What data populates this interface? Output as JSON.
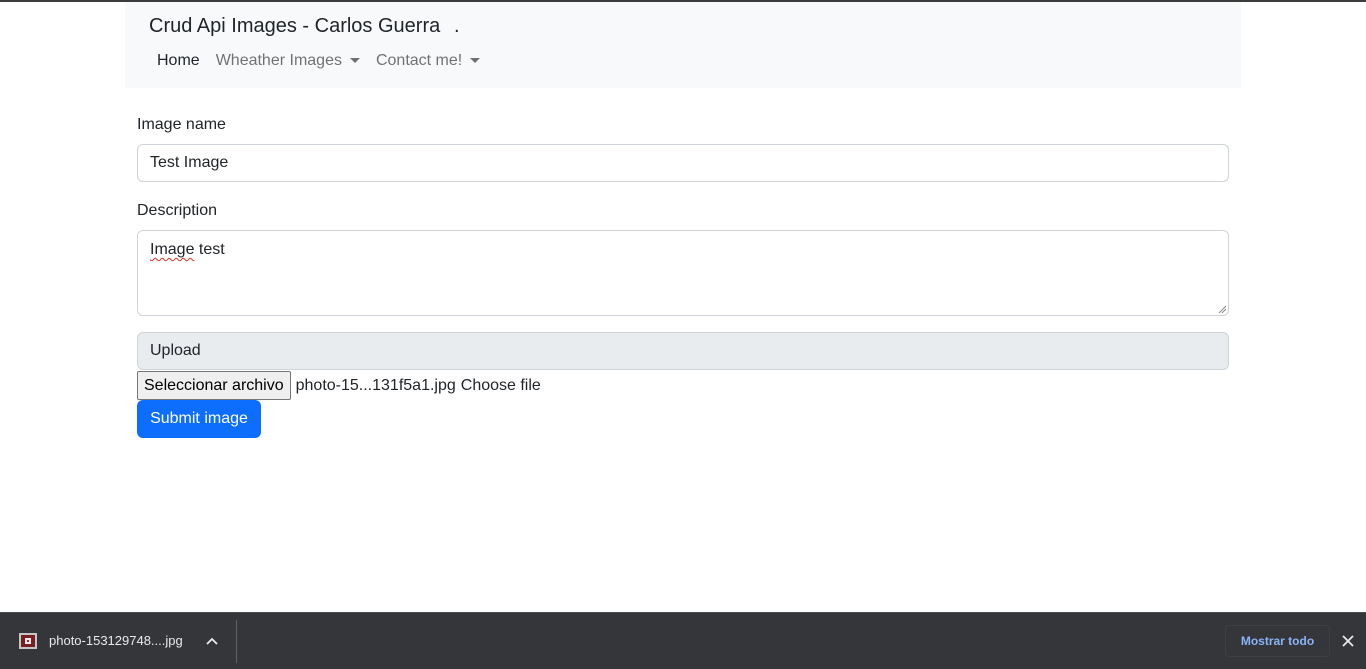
{
  "navbar": {
    "brand": "Crud Api Images - Carlos Guerra",
    "brand_dot": ".",
    "items": [
      {
        "label": "Home",
        "active": true,
        "dropdown": false
      },
      {
        "label": "Wheather Images",
        "active": false,
        "dropdown": true
      },
      {
        "label": "Contact me!",
        "active": false,
        "dropdown": true
      }
    ]
  },
  "form": {
    "name_label": "Image name",
    "name_value": "Test Image",
    "description_label": "Description",
    "description_misspelled": "Image",
    "description_rest": " test",
    "upload_label": "Upload",
    "file_button": "Seleccionar archivo",
    "file_name": "photo-15...131f5a1.jpg",
    "file_choose": "Choose file",
    "submit_label": "Submit image"
  },
  "download_bar": {
    "file_name": "photo-153129748....jpg",
    "show_all": "Mostrar todo",
    "icons": [
      "image-file-icon",
      "chevron-up-icon",
      "close-icon"
    ]
  },
  "colors": {
    "navbar_bg": "#f8f9fa",
    "primary": "#0d6efd",
    "download_bar_bg": "#35363a",
    "link_blue": "#8ab4f8"
  }
}
